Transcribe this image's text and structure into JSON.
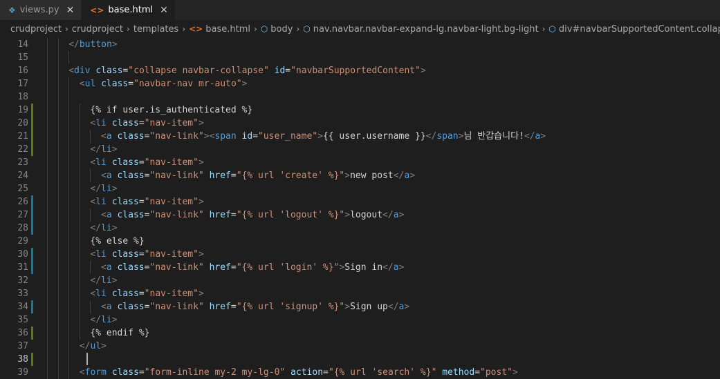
{
  "tabs": [
    {
      "label": "views.py",
      "icon": "python-file-icon",
      "active": false
    },
    {
      "label": "base.html",
      "icon": "html-file-icon",
      "active": true
    }
  ],
  "breadcrumb": [
    {
      "label": "crudproject"
    },
    {
      "label": "crudproject"
    },
    {
      "label": "templates"
    },
    {
      "label": "base.html",
      "icon": "html-file-icon"
    },
    {
      "label": "body",
      "icon": "element-cube-icon"
    },
    {
      "label": "nav.navbar.navbar-expand-lg.navbar-light.bg-light",
      "icon": "element-cube-icon"
    },
    {
      "label": "div#navbarSupportedContent.collapse.navbar-co",
      "icon": "element-cube-icon"
    }
  ],
  "colors": {
    "green_mod": "#587c0c",
    "blue_mod": "#0c7d9d",
    "tag": "#569cd6",
    "attr": "#9cdcfe",
    "string": "#ce9178",
    "text": "#d4d4d4"
  },
  "code_lines": [
    {
      "n": "14",
      "mod": "",
      "indent": 4,
      "tokens": [
        [
          "punct",
          "</"
        ],
        [
          "tag",
          "button"
        ],
        [
          "punct",
          ">"
        ]
      ]
    },
    {
      "n": "15",
      "mod": "",
      "indent": 0,
      "tokens": []
    },
    {
      "n": "16",
      "mod": "",
      "indent": 4,
      "tokens": [
        [
          "punct",
          "<"
        ],
        [
          "tag",
          "div"
        ],
        [
          "text",
          " "
        ],
        [
          "attr",
          "class"
        ],
        [
          "text",
          "="
        ],
        [
          "str",
          "\"collapse navbar-collapse\""
        ],
        [
          "text",
          " "
        ],
        [
          "attr",
          "id"
        ],
        [
          "text",
          "="
        ],
        [
          "str",
          "\"navbarSupportedContent\""
        ],
        [
          "punct",
          ">"
        ]
      ]
    },
    {
      "n": "17",
      "mod": "",
      "indent": 6,
      "tokens": [
        [
          "punct",
          "<"
        ],
        [
          "tag",
          "ul"
        ],
        [
          "text",
          " "
        ],
        [
          "attr",
          "class"
        ],
        [
          "text",
          "="
        ],
        [
          "str",
          "\"navbar-nav mr-auto\""
        ],
        [
          "punct",
          ">"
        ]
      ]
    },
    {
      "n": "18",
      "mod": "",
      "indent": 0,
      "tokens": []
    },
    {
      "n": "19",
      "mod": "green",
      "indent": 8,
      "tokens": [
        [
          "text",
          "{% if user.is_authenticated %}"
        ]
      ]
    },
    {
      "n": "20",
      "mod": "green",
      "indent": 8,
      "tokens": [
        [
          "punct",
          "<"
        ],
        [
          "tag",
          "li"
        ],
        [
          "text",
          " "
        ],
        [
          "attr",
          "class"
        ],
        [
          "text",
          "="
        ],
        [
          "str",
          "\"nav-item\""
        ],
        [
          "punct",
          ">"
        ]
      ]
    },
    {
      "n": "21",
      "mod": "green",
      "indent": 10,
      "tokens": [
        [
          "punct",
          "<"
        ],
        [
          "tag",
          "a"
        ],
        [
          "text",
          " "
        ],
        [
          "attr",
          "class"
        ],
        [
          "text",
          "="
        ],
        [
          "str",
          "\"nav-link\""
        ],
        [
          "punct",
          ">"
        ],
        [
          "punct",
          "<"
        ],
        [
          "tag",
          "span"
        ],
        [
          "text",
          " "
        ],
        [
          "attr",
          "id"
        ],
        [
          "text",
          "="
        ],
        [
          "str",
          "\"user_name\""
        ],
        [
          "punct",
          ">"
        ],
        [
          "text",
          "{{ user.username }}"
        ],
        [
          "punct",
          "</"
        ],
        [
          "tag",
          "span"
        ],
        [
          "punct",
          ">"
        ],
        [
          "text",
          "님 반갑습니다!"
        ],
        [
          "punct",
          "</"
        ],
        [
          "tag",
          "a"
        ],
        [
          "punct",
          ">"
        ]
      ]
    },
    {
      "n": "22",
      "mod": "green",
      "indent": 8,
      "tokens": [
        [
          "punct",
          "</"
        ],
        [
          "tag",
          "li"
        ],
        [
          "punct",
          ">"
        ]
      ]
    },
    {
      "n": "23",
      "mod": "",
      "indent": 8,
      "tokens": [
        [
          "punct",
          "<"
        ],
        [
          "tag",
          "li"
        ],
        [
          "text",
          " "
        ],
        [
          "attr",
          "class"
        ],
        [
          "text",
          "="
        ],
        [
          "str",
          "\"nav-item\""
        ],
        [
          "punct",
          ">"
        ]
      ]
    },
    {
      "n": "24",
      "mod": "",
      "indent": 10,
      "tokens": [
        [
          "punct",
          "<"
        ],
        [
          "tag",
          "a"
        ],
        [
          "text",
          " "
        ],
        [
          "attr",
          "class"
        ],
        [
          "text",
          "="
        ],
        [
          "str",
          "\"nav-link\""
        ],
        [
          "text",
          " "
        ],
        [
          "attr",
          "href"
        ],
        [
          "text",
          "="
        ],
        [
          "str",
          "\"{% url 'create' %}\""
        ],
        [
          "punct",
          ">"
        ],
        [
          "text",
          "new post"
        ],
        [
          "punct",
          "</"
        ],
        [
          "tag",
          "a"
        ],
        [
          "punct",
          ">"
        ]
      ]
    },
    {
      "n": "25",
      "mod": "",
      "indent": 8,
      "tokens": [
        [
          "punct",
          "</"
        ],
        [
          "tag",
          "li"
        ],
        [
          "punct",
          ">"
        ]
      ]
    },
    {
      "n": "26",
      "mod": "blue",
      "indent": 8,
      "tokens": [
        [
          "punct",
          "<"
        ],
        [
          "tag",
          "li"
        ],
        [
          "text",
          " "
        ],
        [
          "attr",
          "class"
        ],
        [
          "text",
          "="
        ],
        [
          "str",
          "\"nav-item\""
        ],
        [
          "punct",
          ">"
        ]
      ]
    },
    {
      "n": "27",
      "mod": "blue",
      "indent": 10,
      "tokens": [
        [
          "punct",
          "<"
        ],
        [
          "tag",
          "a"
        ],
        [
          "text",
          " "
        ],
        [
          "attr",
          "class"
        ],
        [
          "text",
          "="
        ],
        [
          "str",
          "\"nav-link\""
        ],
        [
          "text",
          " "
        ],
        [
          "attr",
          "href"
        ],
        [
          "text",
          "="
        ],
        [
          "str",
          "\"{% url 'logout' %}\""
        ],
        [
          "punct",
          ">"
        ],
        [
          "text",
          "logout"
        ],
        [
          "punct",
          "</"
        ],
        [
          "tag",
          "a"
        ],
        [
          "punct",
          ">"
        ]
      ]
    },
    {
      "n": "28",
      "mod": "blue",
      "indent": 8,
      "tokens": [
        [
          "punct",
          "</"
        ],
        [
          "tag",
          "li"
        ],
        [
          "punct",
          ">"
        ]
      ]
    },
    {
      "n": "29",
      "mod": "",
      "indent": 8,
      "tokens": [
        [
          "text",
          "{% else %}"
        ]
      ]
    },
    {
      "n": "30",
      "mod": "blue",
      "indent": 8,
      "tokens": [
        [
          "punct",
          "<"
        ],
        [
          "tag",
          "li"
        ],
        [
          "text",
          " "
        ],
        [
          "attr",
          "class"
        ],
        [
          "text",
          "="
        ],
        [
          "str",
          "\"nav-item\""
        ],
        [
          "punct",
          ">"
        ]
      ]
    },
    {
      "n": "31",
      "mod": "blue",
      "indent": 10,
      "tokens": [
        [
          "punct",
          "<"
        ],
        [
          "tag",
          "a"
        ],
        [
          "text",
          " "
        ],
        [
          "attr",
          "class"
        ],
        [
          "text",
          "="
        ],
        [
          "str",
          "\"nav-link\""
        ],
        [
          "text",
          " "
        ],
        [
          "attr",
          "href"
        ],
        [
          "text",
          "="
        ],
        [
          "str",
          "\"{% url 'login' %}\""
        ],
        [
          "punct",
          ">"
        ],
        [
          "text",
          "Sign in"
        ],
        [
          "punct",
          "</"
        ],
        [
          "tag",
          "a"
        ],
        [
          "punct",
          ">"
        ]
      ]
    },
    {
      "n": "32",
      "mod": "",
      "indent": 8,
      "tokens": [
        [
          "punct",
          "</"
        ],
        [
          "tag",
          "li"
        ],
        [
          "punct",
          ">"
        ]
      ]
    },
    {
      "n": "33",
      "mod": "",
      "indent": 8,
      "tokens": [
        [
          "punct",
          "<"
        ],
        [
          "tag",
          "li"
        ],
        [
          "text",
          " "
        ],
        [
          "attr",
          "class"
        ],
        [
          "text",
          "="
        ],
        [
          "str",
          "\"nav-item\""
        ],
        [
          "punct",
          ">"
        ]
      ]
    },
    {
      "n": "34",
      "mod": "blue",
      "indent": 10,
      "tokens": [
        [
          "punct",
          "<"
        ],
        [
          "tag",
          "a"
        ],
        [
          "text",
          " "
        ],
        [
          "attr",
          "class"
        ],
        [
          "text",
          "="
        ],
        [
          "str",
          "\"nav-link\""
        ],
        [
          "text",
          " "
        ],
        [
          "attr",
          "href"
        ],
        [
          "text",
          "="
        ],
        [
          "str",
          "\"{% url 'signup' %}\""
        ],
        [
          "punct",
          ">"
        ],
        [
          "text",
          "Sign up"
        ],
        [
          "punct",
          "</"
        ],
        [
          "tag",
          "a"
        ],
        [
          "punct",
          ">"
        ]
      ]
    },
    {
      "n": "35",
      "mod": "",
      "indent": 8,
      "tokens": [
        [
          "punct",
          "</"
        ],
        [
          "tag",
          "li"
        ],
        [
          "punct",
          ">"
        ]
      ]
    },
    {
      "n": "36",
      "mod": "green",
      "indent": 8,
      "tokens": [
        [
          "text",
          "{% endif %}"
        ]
      ]
    },
    {
      "n": "37",
      "mod": "",
      "indent": 6,
      "tokens": [
        [
          "punct",
          "</"
        ],
        [
          "tag",
          "ul"
        ],
        [
          "punct",
          ">"
        ]
      ]
    },
    {
      "n": "38",
      "mod": "green",
      "indent": 0,
      "current": true,
      "tokens": []
    },
    {
      "n": "39",
      "mod": "",
      "indent": 6,
      "tokens": [
        [
          "punct",
          "<"
        ],
        [
          "tag",
          "form"
        ],
        [
          "text",
          " "
        ],
        [
          "attr",
          "class"
        ],
        [
          "text",
          "="
        ],
        [
          "str",
          "\"form-inline my-2 my-lg-0\""
        ],
        [
          "text",
          " "
        ],
        [
          "attr",
          "action"
        ],
        [
          "text",
          "="
        ],
        [
          "str",
          "\"{% url 'search' %}\""
        ],
        [
          "text",
          " "
        ],
        [
          "attr",
          "method"
        ],
        [
          "text",
          "="
        ],
        [
          "str",
          "\"post\""
        ],
        [
          "punct",
          ">"
        ]
      ]
    }
  ]
}
